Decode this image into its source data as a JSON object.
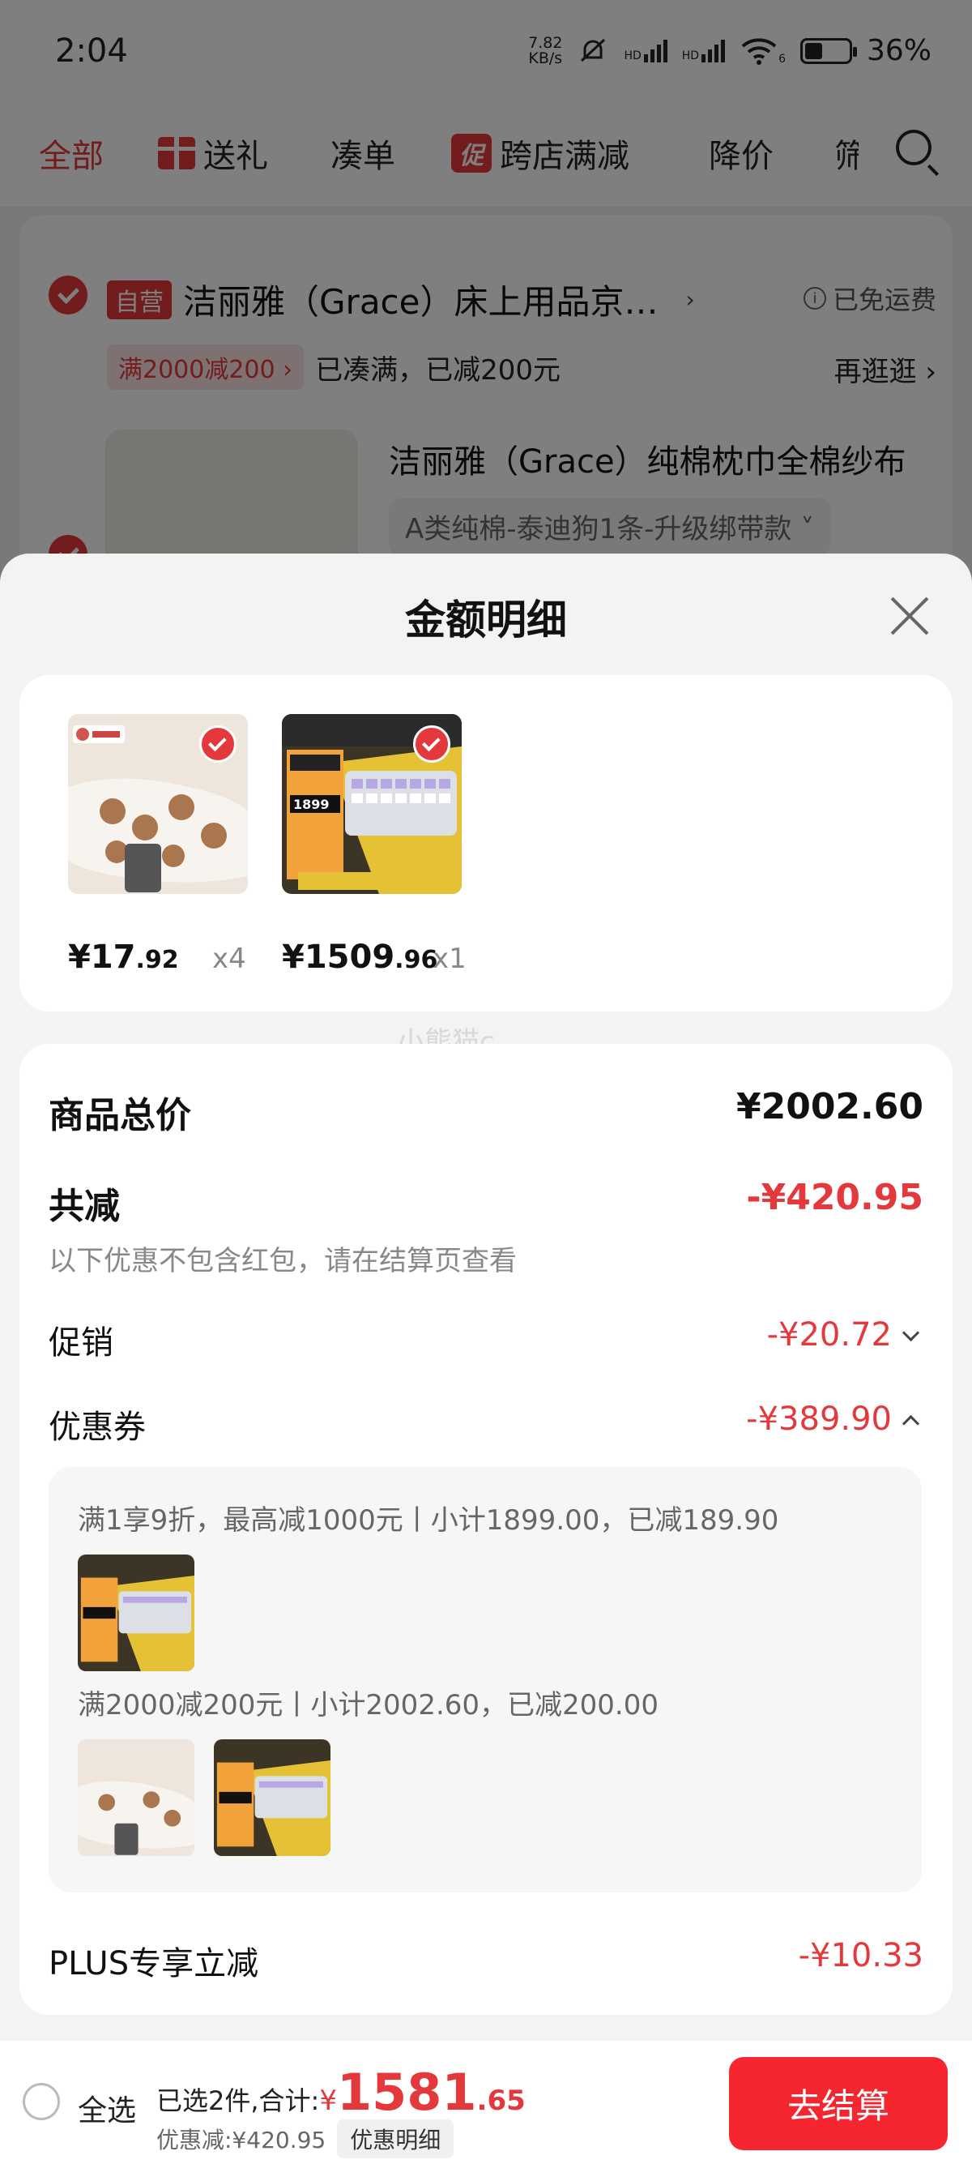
{
  "status_bar": {
    "time": "2:04",
    "net_speed_value": "7.82",
    "net_speed_unit": "KB/s",
    "hd1": "HD",
    "hd2": "HD",
    "wifi_badge": "6",
    "battery_percent": "36%",
    "battery_level": 0.36
  },
  "tabs": [
    {
      "label": "全部",
      "active": true
    },
    {
      "label": "送礼",
      "icon": "gift-icon"
    },
    {
      "label": "凑单"
    },
    {
      "label": "跨店满减",
      "badge": "促"
    },
    {
      "label": "降价"
    },
    {
      "label": "筛"
    }
  ],
  "cart": {
    "store_badge": "自营",
    "store_name": "洁丽雅（Grace）床上用品京…",
    "shipping_note": "已免运费",
    "promo_tag": "满2000减200",
    "promo_status": "已凑满，已减200元",
    "browse_more": "再逛逛",
    "product_title": "洁丽雅（Grace）纯棉枕巾全棉纱布",
    "product_spec": "A类纯棉-泰迪狗1条-升级绑带款"
  },
  "sheet": {
    "title": "金额明细",
    "items": [
      {
        "price_int": "¥17",
        "price_dec": ".92",
        "qty": "x4",
        "image": "pillow-towel"
      },
      {
        "price_int": "¥1509",
        "price_dec": ".96",
        "qty": "x1",
        "image": "keyboard"
      }
    ],
    "watermark": "小熊猫c",
    "goods_total_label": "商品总价",
    "goods_total_value": "¥2002.60",
    "discount_label": "共减",
    "discount_value": "-¥420.95",
    "discount_note": "以下优惠不包含红包，请在结算页查看",
    "promo_label": "促销",
    "promo_value": "-¥20.72",
    "coupon_label": "优惠券",
    "coupon_value": "-¥389.90",
    "coupon_lines": [
      "满1享9折，最高减1000元丨小计1899.00，已减189.90",
      "满2000减200元丨小计2002.60，已减200.00"
    ],
    "plus_label": "PLUS专享立减",
    "plus_value": "-¥10.33"
  },
  "bottom_bar": {
    "select_all": "全选",
    "selected_summary": "已选2件,合计:",
    "currency": "¥",
    "total_int": "1581",
    "total_dec": ".65",
    "discount_summary": "优惠减:¥420.95",
    "detail_button": "优惠明细",
    "checkout_button": "去结算"
  },
  "colors": {
    "accent": "#e4393c",
    "checkout": "#f5262f"
  }
}
